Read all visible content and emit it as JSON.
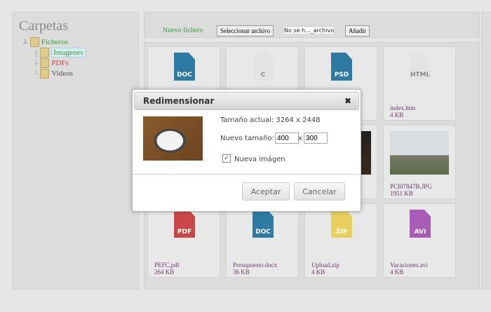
{
  "sidebar": {
    "title": "Carpetas",
    "root": "Ficheros",
    "folders": [
      {
        "label": "Imagenes",
        "color": "#3a9a3a",
        "selected": true
      },
      {
        "label": "PDFs",
        "color": "#c04040"
      },
      {
        "label": "Videos",
        "color": "#555"
      }
    ]
  },
  "upload": {
    "label": "Nuevo fichero",
    "select_button": "Seleccionar archivo",
    "file_status": "No se h..._archivo",
    "add_button": "Añadir"
  },
  "files": [
    {
      "type": "icon",
      "ext": "DOC",
      "color": "#2f7aa3"
    },
    {
      "type": "icon",
      "ext": "C",
      "color": "#e4e4e4",
      "textColor": "#888"
    },
    {
      "type": "icon",
      "ext": "PSD",
      "color": "#2f7aa3"
    },
    {
      "type": "icon",
      "ext": "HTML",
      "color": "#e4e4e4",
      "textColor": "#888",
      "name": "index.htm",
      "size": "4 KB"
    },
    {
      "type": "hidden"
    },
    {
      "type": "hidden"
    },
    {
      "type": "photo",
      "photo": "dark"
    },
    {
      "type": "photo",
      "photo": "sky",
      "name": "PCI07847B.JPG",
      "size": "1951 KB"
    },
    {
      "type": "icon",
      "ext": "PDF",
      "color": "#c9474a",
      "name": "PEFC.pdf",
      "size": "264 KB"
    },
    {
      "type": "icon",
      "ext": "DOC",
      "color": "#2f7aa3",
      "name": "Presupuesto.docx",
      "size": "36 KB"
    },
    {
      "type": "icon",
      "ext": "ZIP",
      "color": "#e8cf5e",
      "name": "Upload.zip",
      "size": "4 KB"
    },
    {
      "type": "icon",
      "ext": "AVI",
      "color": "#a85cb5",
      "name": "Vacaciones.avi",
      "size": "4 KB"
    }
  ],
  "dialog": {
    "title": "Redimensionar",
    "close": "✖",
    "current_label": "Tamaño actual: 3264 x 2448",
    "new_label": "Nuevo tamaño:",
    "width": "400",
    "times": "x",
    "height": "300",
    "checkbox_label": "Nueva imágen",
    "checked": true,
    "accept": "Aceptar",
    "cancel": "Cancelar"
  }
}
